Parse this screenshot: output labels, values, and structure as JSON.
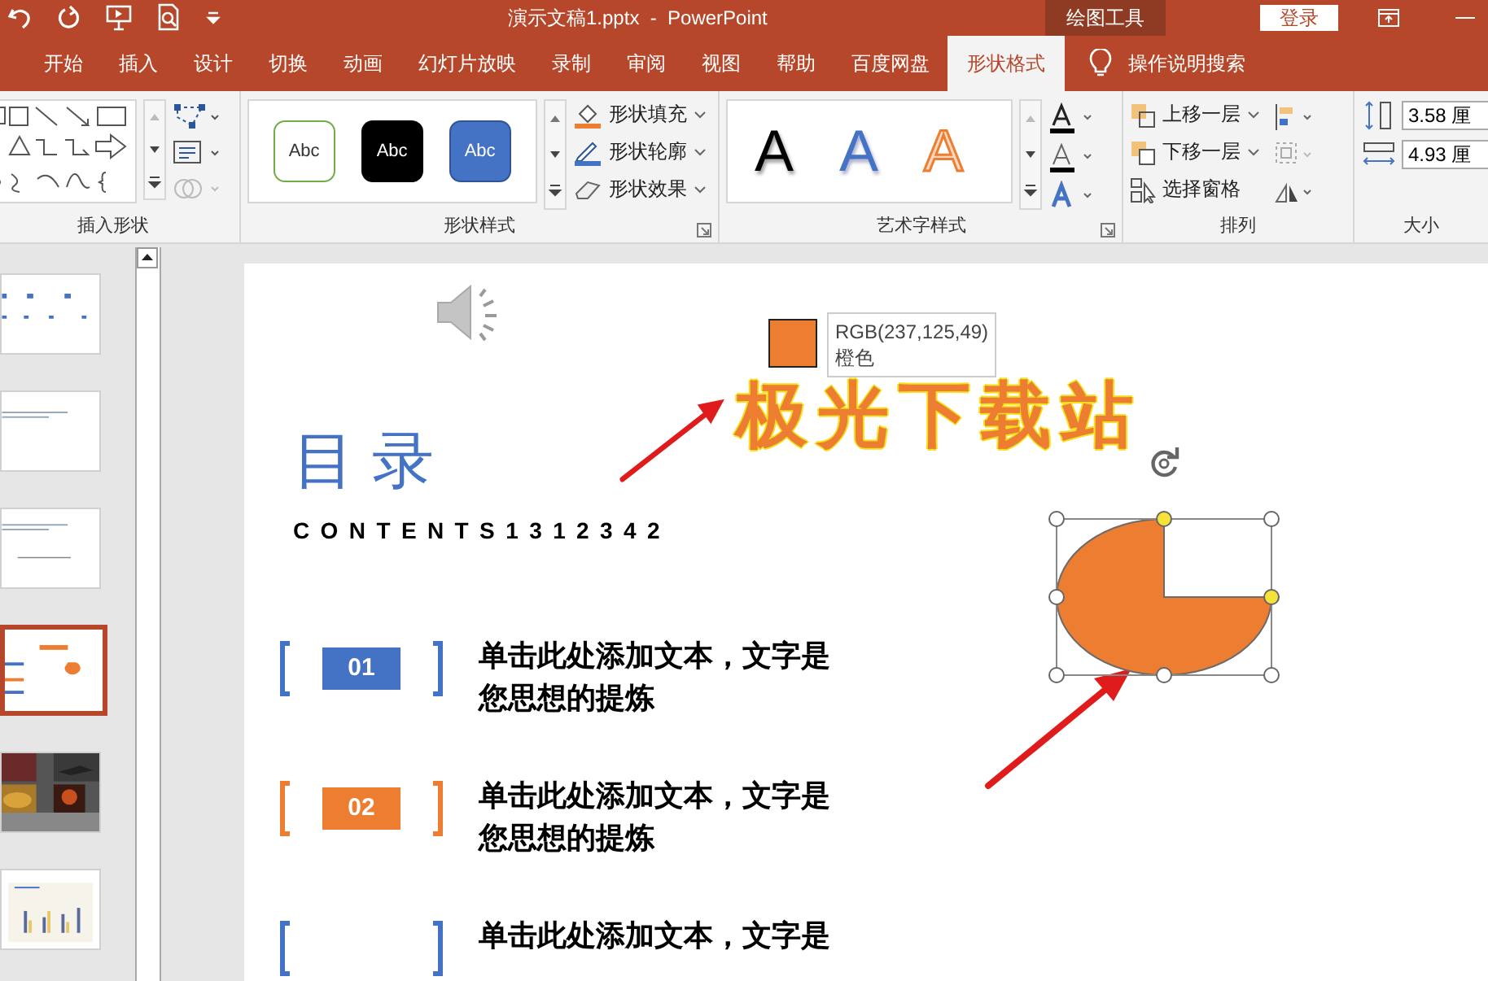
{
  "title_bar": {
    "document_title": "演示文稿1.pptx  -  PowerPoint",
    "context_tab": "绘图工具",
    "sign_in": "登录"
  },
  "tabs": [
    {
      "label": "开始",
      "selected": false
    },
    {
      "label": "插入",
      "selected": false
    },
    {
      "label": "设计",
      "selected": false
    },
    {
      "label": "切换",
      "selected": false
    },
    {
      "label": "动画",
      "selected": false
    },
    {
      "label": "幻灯片放映",
      "selected": false
    },
    {
      "label": "录制",
      "selected": false
    },
    {
      "label": "审阅",
      "selected": false
    },
    {
      "label": "视图",
      "selected": false
    },
    {
      "label": "帮助",
      "selected": false
    },
    {
      "label": "百度网盘",
      "selected": false
    },
    {
      "label": "形状格式",
      "selected": true
    }
  ],
  "tell_me": "操作说明搜索",
  "insert_shapes": {
    "label": "插入形状"
  },
  "shape_styles": {
    "label": "形状样式",
    "presets": [
      {
        "label": "Abc",
        "kind": "outline"
      },
      {
        "label": "Abc",
        "kind": "dark"
      },
      {
        "label": "Abc",
        "kind": "blue"
      }
    ],
    "commands": [
      "形状填充",
      "形状轮廓",
      "形状效果"
    ]
  },
  "wordart_styles": {
    "label": "艺术字样式",
    "samples": [
      {
        "label": "A",
        "kind": "black"
      },
      {
        "label": "A",
        "kind": "blue"
      },
      {
        "label": "A",
        "kind": "orange"
      }
    ]
  },
  "arrange": {
    "label": "排列",
    "commands": [
      "上移一层",
      "下移一层",
      "选择窗格"
    ]
  },
  "size": {
    "label": "大小",
    "height": "3.58 厘",
    "width": "4.93 厘"
  },
  "thumbnails": [
    {
      "kind": "toc",
      "selected": false
    },
    {
      "kind": "text",
      "selected": false
    },
    {
      "kind": "line",
      "selected": false
    },
    {
      "kind": "current",
      "selected": true
    },
    {
      "kind": "picture",
      "selected": false
    },
    {
      "kind": "chart",
      "selected": false
    }
  ],
  "slide": {
    "title": "极光下载站",
    "heading": "目 录",
    "subheading": "CONTENTS1312342",
    "tooltip": {
      "color": "#ed7d31",
      "rgb": "RGB(237,125,49)",
      "name": "橙色"
    },
    "items": [
      {
        "number": "01",
        "text": "单击此处添加文本，文字是您思想的提炼",
        "color": "#4472c4"
      },
      {
        "number": "02",
        "text": "单击此处添加文本，文字是您思想的提炼",
        "color": "#ed7d31"
      },
      {
        "text": "单击此处添加文本，文字是",
        "color": "#4472c4"
      }
    ]
  }
}
